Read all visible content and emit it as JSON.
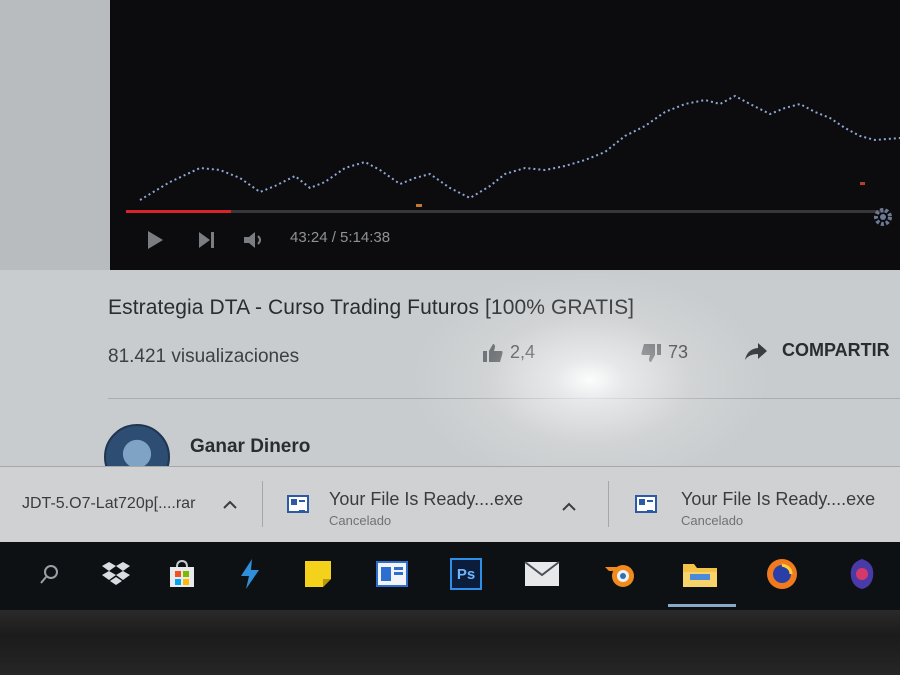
{
  "player": {
    "time_display": "43:24 / 5:14:38",
    "progress_fraction": 0.138,
    "accent_color": "#d8232a",
    "controls": [
      "play-icon",
      "next-icon",
      "volume-icon",
      "settings-icon"
    ]
  },
  "video": {
    "title": "Estrategia DTA - Curso Trading Futuros [100% GRATIS]",
    "views": "81.421 visualizaciones",
    "likes": "2,4",
    "dislikes": "73",
    "share_label": "COMPARTIR"
  },
  "channel": {
    "name": "Ganar Dinero"
  },
  "downloads": [
    {
      "name": "JDT-5.O7-Lat720p[....rar",
      "status": ""
    },
    {
      "name": "Your File Is Ready....exe",
      "status": "Cancelado"
    },
    {
      "name": "Your File Is Ready....exe",
      "status": "Cancelado"
    }
  ],
  "taskbar": {
    "icons": [
      "search-icon",
      "dropbox-icon",
      "store-icon",
      "bolt-icon",
      "sticky-notes-icon",
      "window-app-icon",
      "photoshop-icon",
      "mail-icon",
      "blender-icon",
      "file-explorer-icon",
      "firefox-icon",
      "app-icon"
    ],
    "photoshop_label": "Ps"
  }
}
